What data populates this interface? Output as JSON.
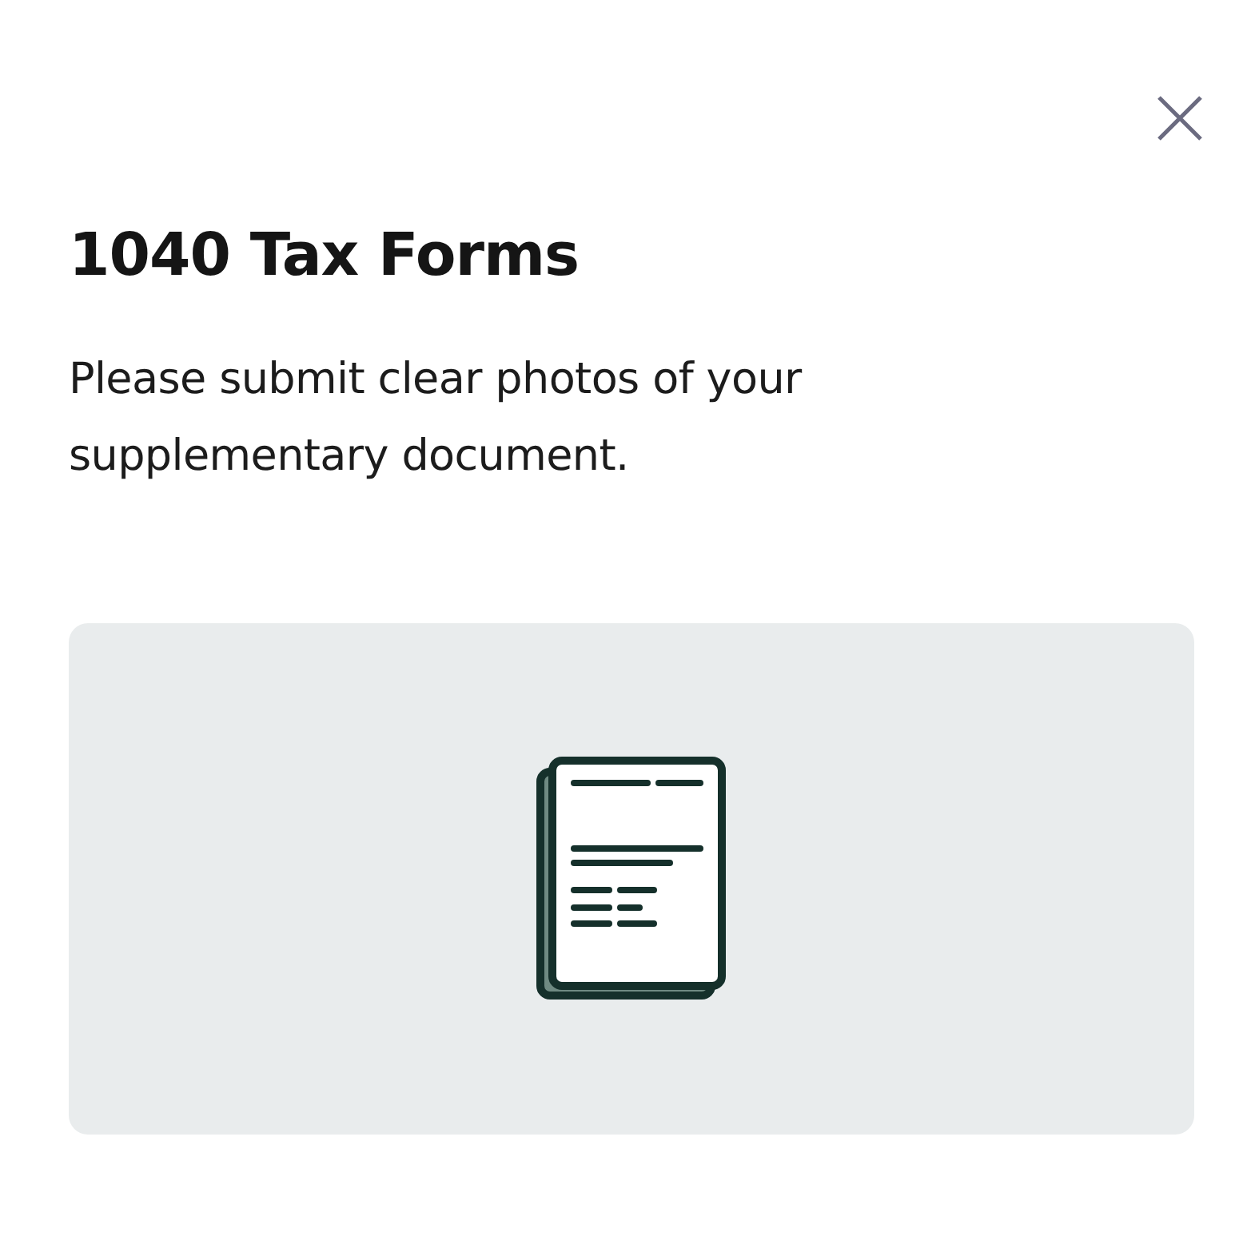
{
  "title": "1040 Tax Forms",
  "description": "Please submit clear photos of your supplementary document."
}
